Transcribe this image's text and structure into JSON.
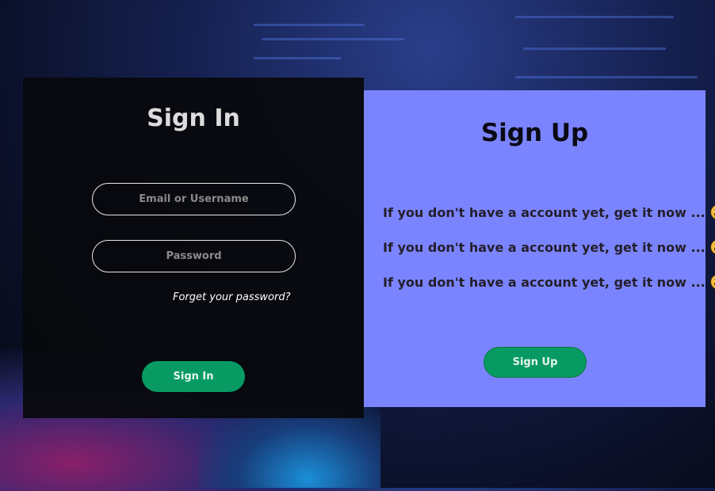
{
  "signin": {
    "title": "Sign In",
    "email_placeholder": "Email or Username",
    "password_placeholder": "Password",
    "forgot_link": "Forget your password?",
    "button": "Sign In"
  },
  "signup": {
    "title": "Sign Up",
    "lines": [
      "If you don't have a account yet, get it now ...",
      "If you don't have a account yet, get it now ...",
      "If you don't have a account yet, get it now ..."
    ],
    "emoji_icon": "grinning-face-with-smiling-eyes",
    "button": "Sign Up"
  },
  "colors": {
    "signup_bg": "#7b84ff",
    "button_green": "#079a62"
  }
}
